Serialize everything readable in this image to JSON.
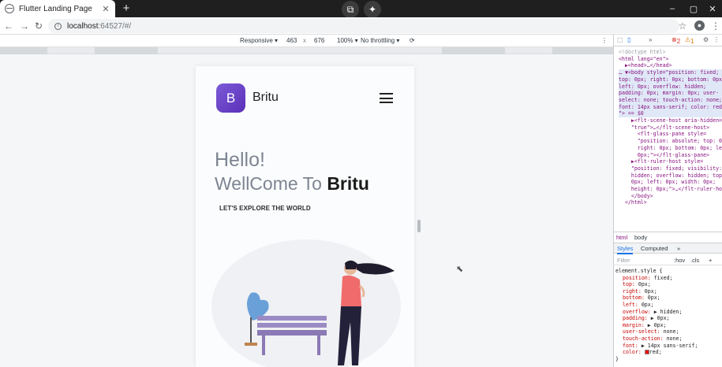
{
  "browser": {
    "tab_title": "Flutter Landing Page",
    "tab_close": "✕",
    "new_tab": "+",
    "url_host": "localhost",
    "url_path": ":64527/#/",
    "overlay_icons": [
      "picture-in-picture-icon",
      "sparkle-icon"
    ],
    "window_controls": [
      "–",
      "▢",
      "✕"
    ]
  },
  "device_toolbar": {
    "mode": "Responsive ▾",
    "width": "463",
    "times": "x",
    "height": "676",
    "zoom": "100% ▾",
    "throttle": "No throttling ▾"
  },
  "app": {
    "logo_letter": "B",
    "brand": "Britu",
    "hello": "Hello!",
    "welcome_prefix": "WellCome To ",
    "welcome_brand": "Britu",
    "explore": "LET'S EXPLORE THE WORLD"
  },
  "devtools": {
    "errors": "2",
    "warnings": "1",
    "elements_lines": [
      "<!doctype html>",
      "<html lang=\"en\">",
      "  ▶<head>…</head>",
      "… ▼<body style=\"position: fixed;",
      "top: 0px; right: 0px; bottom: 0px;",
      "left: 0px; overflow: hidden;",
      "padding: 0px; margin: 0px; user-",
      "select: none; touch-action: none;",
      "font: 14px sans-serif; color: red;",
      "\"> == $0",
      "    ▶<flt-scene-host aria-hidden=",
      "    \"true\">…</flt-scene-host>",
      "      <flt-glass-pane style=",
      "      \"position: absolute; top: 0px;",
      "      right: 0px; bottom: 0px; left:",
      "      0px;\"></flt-glass-pane>",
      "    ▶<flt-ruler-host style=",
      "    \"position: fixed; visibility:",
      "    hidden; overflow: hidden; top:",
      "    0px; left: 0px; width: 0px;",
      "    height: 0px;\">…</flt-ruler-host>",
      "    </body>",
      "  </html>"
    ],
    "crumbs": [
      "html",
      "body"
    ],
    "styles_tabs": [
      "Styles",
      "Computed",
      "»"
    ],
    "filter_placeholder": "Filter",
    "filter_buttons": [
      ":hov",
      ".cls",
      "+"
    ],
    "rule_selector": "element.style {",
    "props": [
      {
        "name": "position",
        "value": "fixed;"
      },
      {
        "name": "top",
        "value": "0px;"
      },
      {
        "name": "right",
        "value": "0px;"
      },
      {
        "name": "bottom",
        "value": "0px;"
      },
      {
        "name": "left",
        "value": "0px;"
      },
      {
        "name": "overflow",
        "value": "▶ hidden;"
      },
      {
        "name": "padding",
        "value": "▶ 0px;"
      },
      {
        "name": "margin",
        "value": "▶ 0px;"
      },
      {
        "name": "user-select",
        "value": "none;"
      },
      {
        "name": "touch-action",
        "value": "none;"
      },
      {
        "name": "font",
        "value": "▶ 14px sans-serif;"
      },
      {
        "name": "color",
        "value": "red;"
      }
    ],
    "rule_close": "}"
  },
  "colors": {
    "logo_gradient_start": "#7b5bd8",
    "logo_gradient_end": "#5b2fb8",
    "person_shirt": "#f06b6b",
    "bench": "#9b8bc4",
    "plant": "#6aa0d8"
  }
}
